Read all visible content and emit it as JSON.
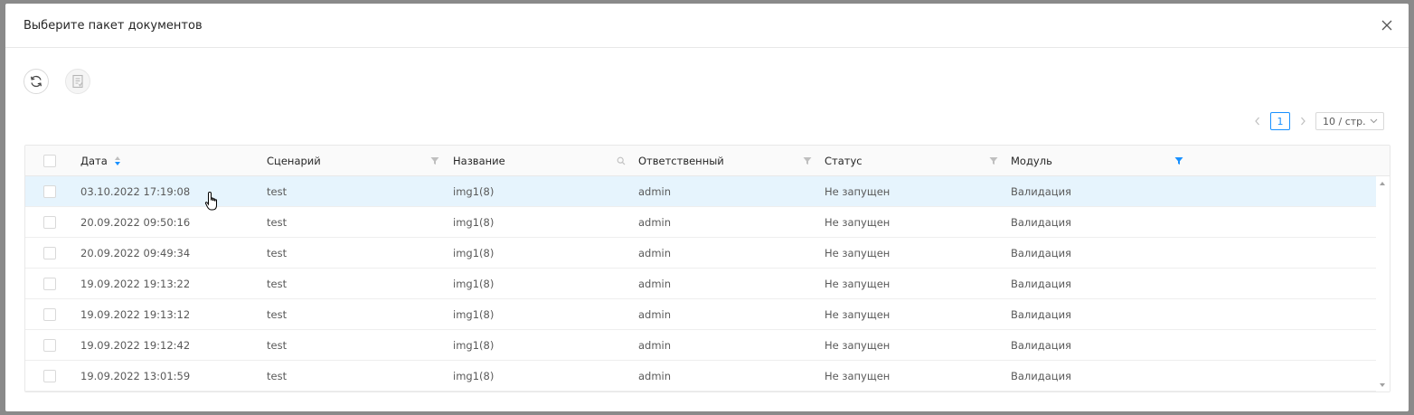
{
  "modal": {
    "title": "Выберите пакет документов"
  },
  "pagination": {
    "current_page": "1",
    "page_size": "10 / стр."
  },
  "table": {
    "columns": [
      {
        "key": "date",
        "label": "Дата"
      },
      {
        "key": "scenario",
        "label": "Сценарий"
      },
      {
        "key": "name",
        "label": "Название"
      },
      {
        "key": "owner",
        "label": "Ответственный"
      },
      {
        "key": "status",
        "label": "Статус"
      },
      {
        "key": "module",
        "label": "Модуль"
      }
    ],
    "rows": [
      {
        "date": "03.10.2022 17:19:08",
        "scenario": "test",
        "name": "img1(8)",
        "owner": "admin",
        "status": "Не запущен",
        "module": "Валидация"
      },
      {
        "date": "20.09.2022 09:50:16",
        "scenario": "test",
        "name": "img1(8)",
        "owner": "admin",
        "status": "Не запущен",
        "module": "Валидация"
      },
      {
        "date": "20.09.2022 09:49:34",
        "scenario": "test",
        "name": "img1(8)",
        "owner": "admin",
        "status": "Не запущен",
        "module": "Валидация"
      },
      {
        "date": "19.09.2022 19:13:22",
        "scenario": "test",
        "name": "img1(8)",
        "owner": "admin",
        "status": "Не запущен",
        "module": "Валидация"
      },
      {
        "date": "19.09.2022 19:13:12",
        "scenario": "test",
        "name": "img1(8)",
        "owner": "admin",
        "status": "Не запущен",
        "module": "Валидация"
      },
      {
        "date": "19.09.2022 19:12:42",
        "scenario": "test",
        "name": "img1(8)",
        "owner": "admin",
        "status": "Не запущен",
        "module": "Валидация"
      },
      {
        "date": "19.09.2022 13:01:59",
        "scenario": "test",
        "name": "img1(8)",
        "owner": "admin",
        "status": "Не запущен",
        "module": "Валидация"
      }
    ]
  },
  "colors": {
    "accent": "#1890ff",
    "active_row": "#e6f4fd"
  },
  "icons": {
    "close": "close-icon",
    "refresh": "refresh-icon",
    "document": "document-icon",
    "sort": "sort-icon",
    "filter": "filter-icon",
    "search": "search-icon"
  }
}
